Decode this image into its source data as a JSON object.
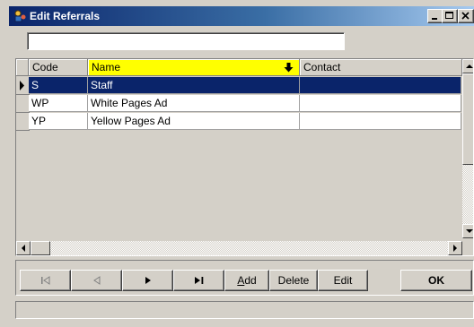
{
  "window": {
    "title": "Edit Referrals",
    "icon": "app-icon",
    "controls": [
      "minimize",
      "maximize",
      "close"
    ]
  },
  "search": {
    "value": "",
    "placeholder": ""
  },
  "grid": {
    "columns": [
      {
        "key": "code",
        "label": "Code"
      },
      {
        "key": "name",
        "label": "Name",
        "highlighted": true,
        "sort_icon": "arrow-down-icon"
      },
      {
        "key": "contact",
        "label": "Contact"
      }
    ],
    "rows": [
      {
        "code": "S",
        "name": "Staff",
        "contact": "",
        "selected": true
      },
      {
        "code": "WP",
        "name": "White Pages Ad",
        "contact": "",
        "selected": false
      },
      {
        "code": "YP",
        "name": "Yellow Pages Ad",
        "contact": "",
        "selected": false
      }
    ]
  },
  "toolbar": {
    "first_icon": "first-record-icon",
    "prev_icon": "prev-record-icon",
    "next_icon": "next-record-icon",
    "last_icon": "last-record-icon",
    "add_label_accel": "A",
    "add_label_rest": "dd",
    "delete_label": "Delete",
    "edit_label": "Edit",
    "ok_label": "OK"
  },
  "status": {
    "text": ""
  },
  "colors": {
    "selection": "#0a246a",
    "header_highlight": "#ffff00",
    "face": "#d4d0c8"
  }
}
